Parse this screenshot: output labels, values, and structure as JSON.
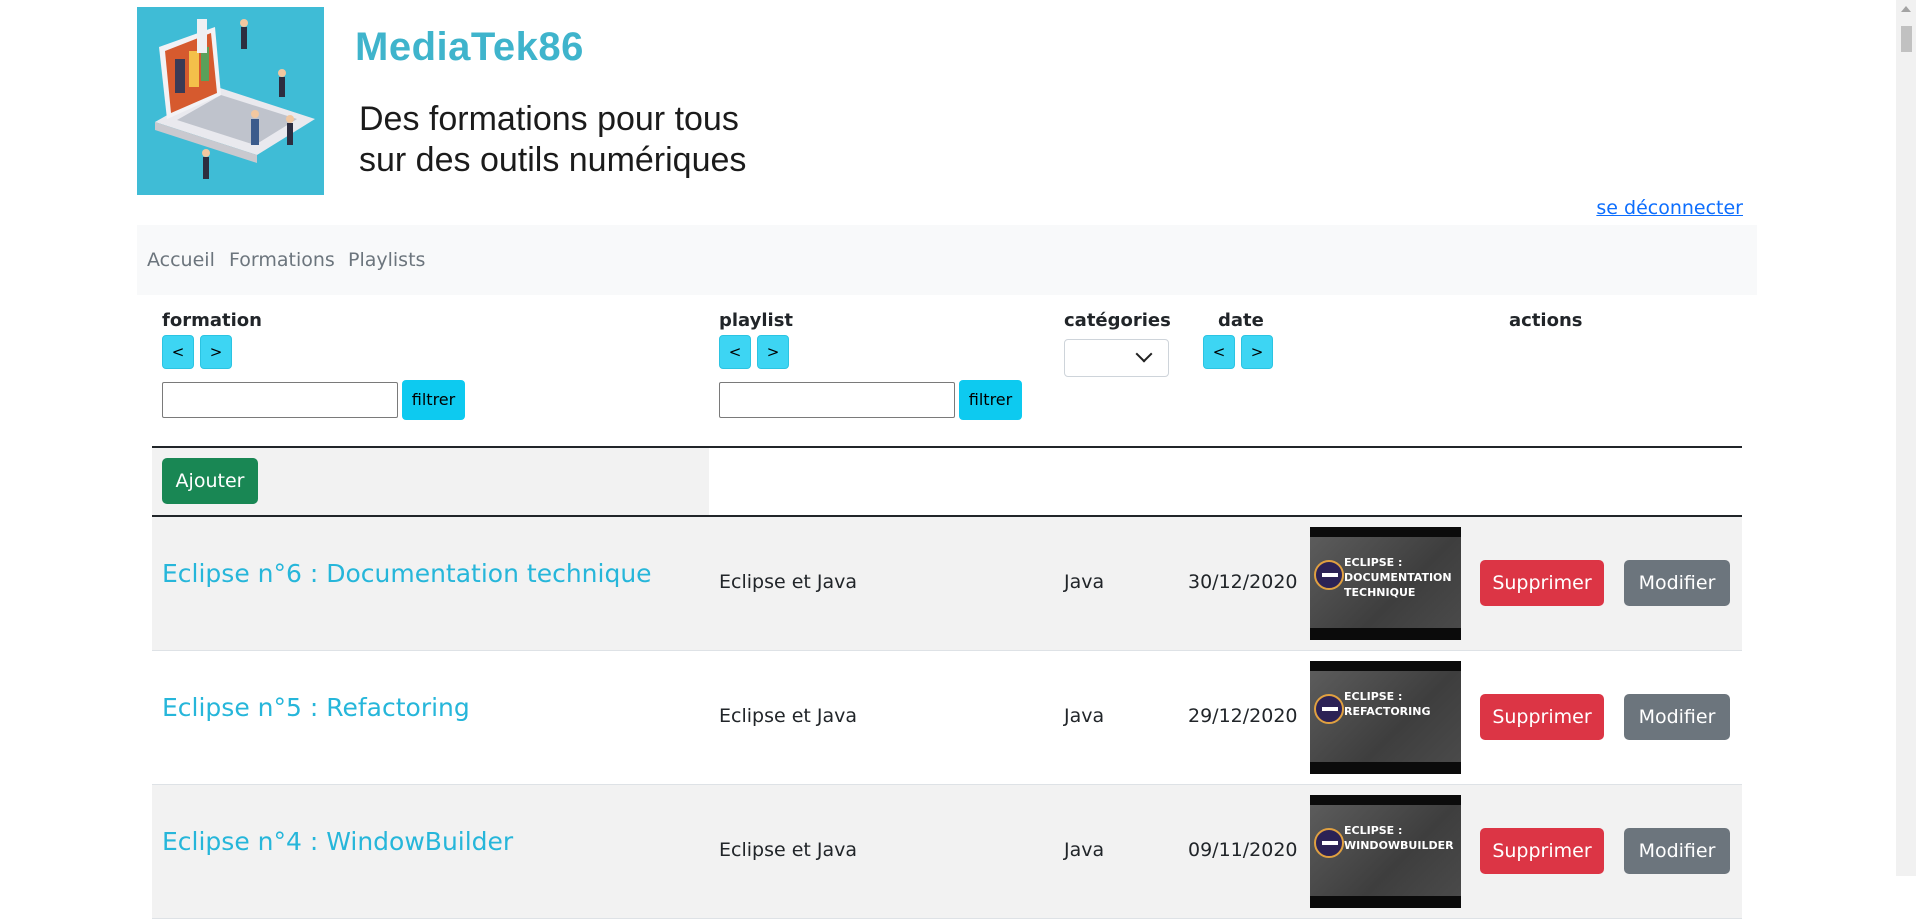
{
  "header": {
    "brand": "MediaTek86",
    "tagline": "Des formations pour tous\nsur des outils numériques",
    "logout_label": "se déconnecter"
  },
  "nav": {
    "items": [
      {
        "label": "Accueil"
      },
      {
        "label": "Formations"
      },
      {
        "label": "Playlists"
      }
    ]
  },
  "table": {
    "headers": {
      "formation": "formation",
      "playlist": "playlist",
      "categories": "catégories",
      "date": "date",
      "actions": "actions"
    },
    "sort_prev": "<",
    "sort_next": ">",
    "filter_label": "filtrer",
    "add_label": "Ajouter",
    "rows": [
      {
        "title": "Eclipse n°6 : Documentation technique",
        "playlist": "Eclipse et Java",
        "category": "Java",
        "date": "30/12/2020",
        "thumb_text": "ECLIPSE :\nDOCUMENTATION\nTECHNIQUE",
        "delete_label": "Supprimer",
        "edit_label": "Modifier"
      },
      {
        "title": "Eclipse n°5 : Refactoring",
        "playlist": "Eclipse et Java",
        "category": "Java",
        "date": "29/12/2020",
        "thumb_text": "ECLIPSE :\nREFACTORING",
        "delete_label": "Supprimer",
        "edit_label": "Modifier"
      },
      {
        "title": "Eclipse n°4 : WindowBuilder",
        "playlist": "Eclipse et Java",
        "category": "Java",
        "date": "09/11/2020",
        "thumb_text": "ECLIPSE :\nWINDOWBUILDER",
        "delete_label": "Supprimer",
        "edit_label": "Modifier"
      }
    ]
  },
  "colors": {
    "brand": "#3fb4cc",
    "title_link": "#26b6da",
    "info_button": "#0dcaf0",
    "add_button": "#198754",
    "delete_button": "#dc3545",
    "edit_button": "#6c757d"
  }
}
